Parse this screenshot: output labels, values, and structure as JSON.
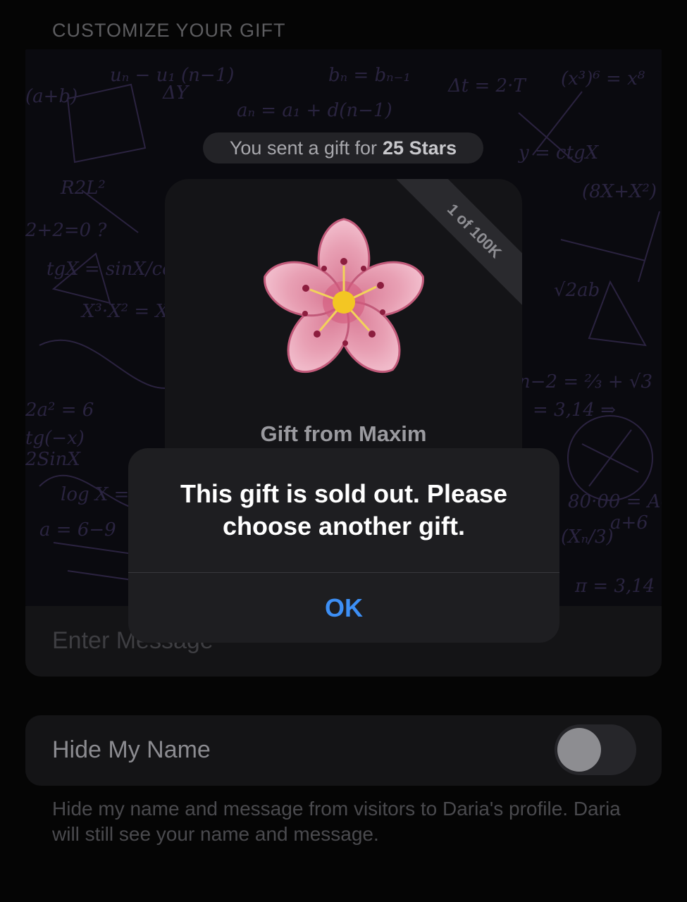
{
  "section_header": "CUSTOMIZE YOUR GIFT",
  "preview": {
    "sent_prefix": "You sent a gift for",
    "sent_amount": "25 Stars",
    "ribbon": "1 of 100K",
    "gift_from": "Gift from Maxim",
    "gift_icon": "cherry-blossom-icon"
  },
  "message_field": {
    "placeholder": "Enter Message"
  },
  "hide_name": {
    "label": "Hide My Name",
    "enabled": false
  },
  "footnote": "Hide my name and message from visitors to Daria's profile. Daria will still see your name and message.",
  "alert": {
    "message": "This gift is sold out. Please choose another gift.",
    "ok_label": "OK"
  },
  "colors": {
    "accent": "#3d8ff5",
    "alert_bg": "#1e1e21",
    "background": "#050505"
  }
}
